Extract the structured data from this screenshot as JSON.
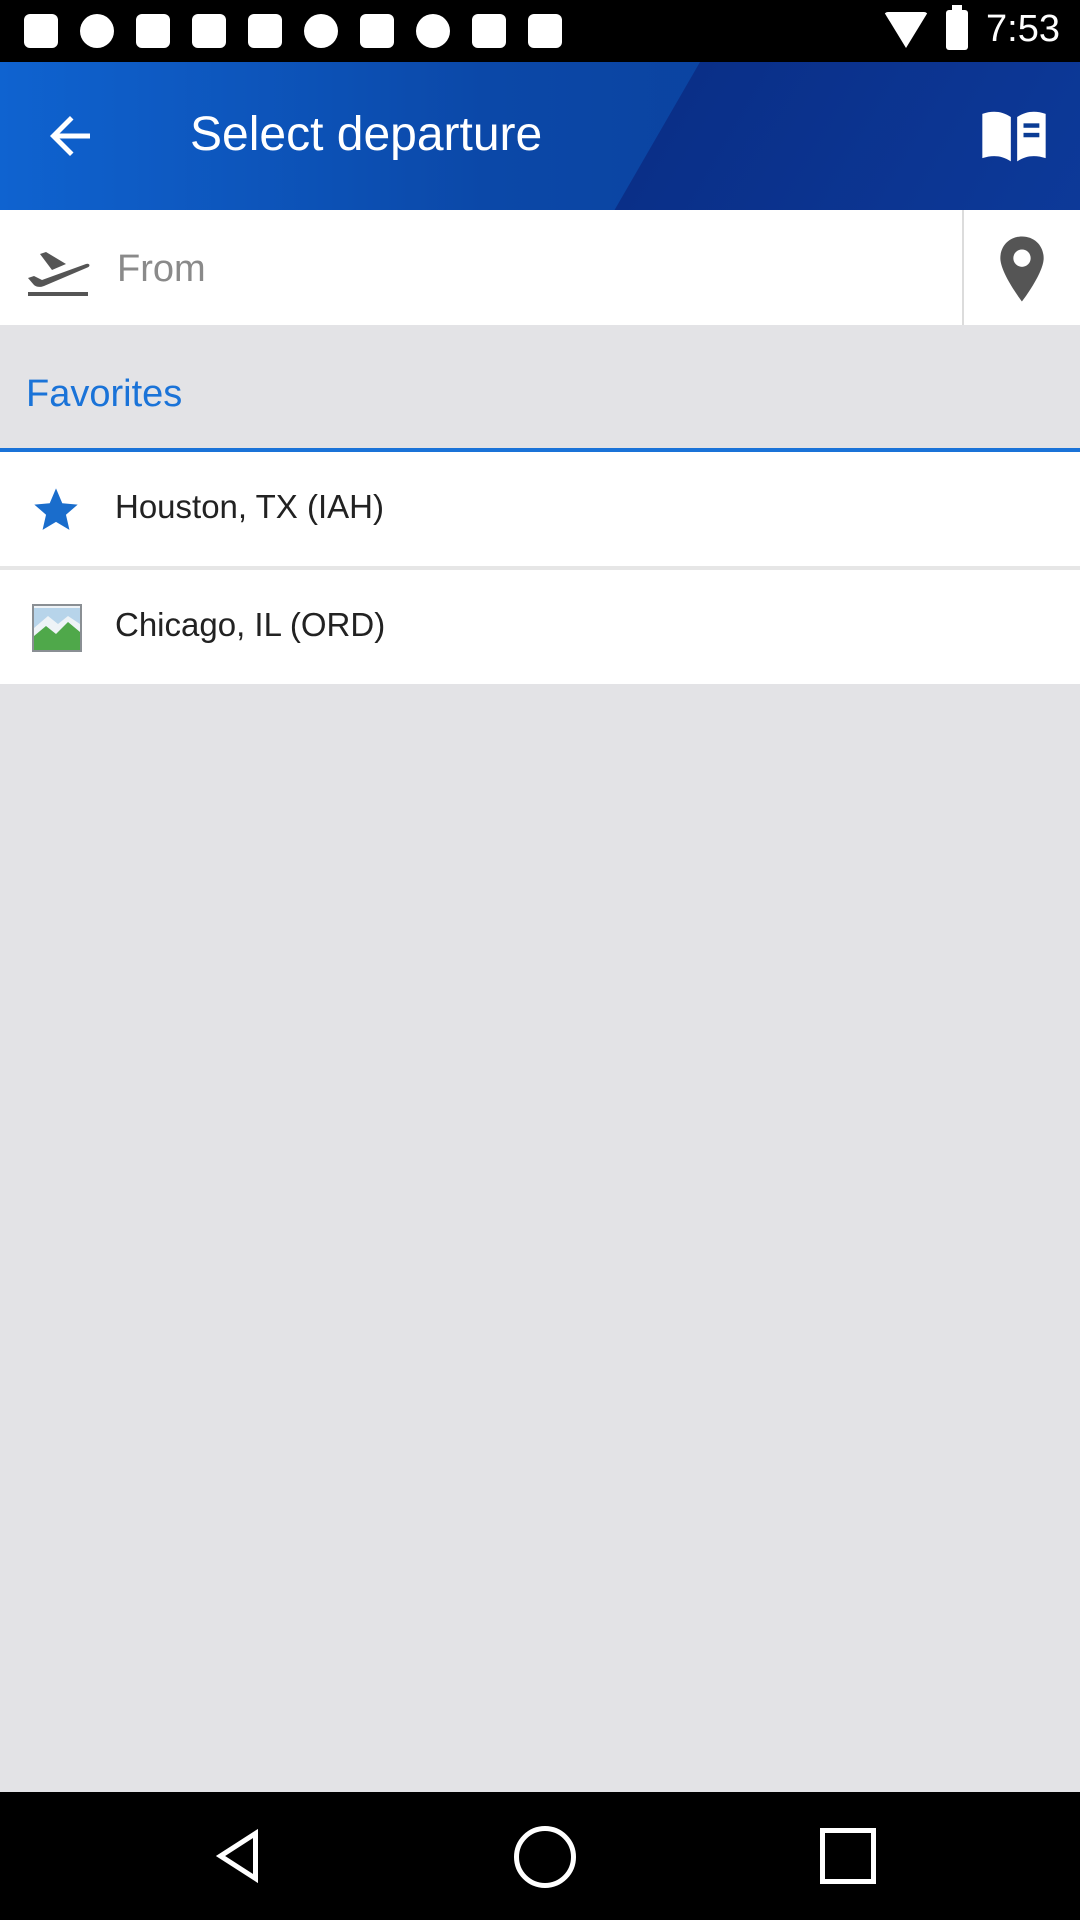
{
  "status_bar": {
    "time": "7:53"
  },
  "header": {
    "title": "Select departure"
  },
  "search": {
    "placeholder": "From"
  },
  "favorites": {
    "title": "Favorites",
    "items": [
      {
        "label": "Houston, TX (IAH)",
        "icon": "star-icon"
      },
      {
        "label": "Chicago, IL (ORD)",
        "icon": "broken-image-icon"
      }
    ]
  },
  "colors": {
    "accent": "#1a73d8",
    "appbar": "#0b48a8",
    "background": "#e3e3e6"
  }
}
